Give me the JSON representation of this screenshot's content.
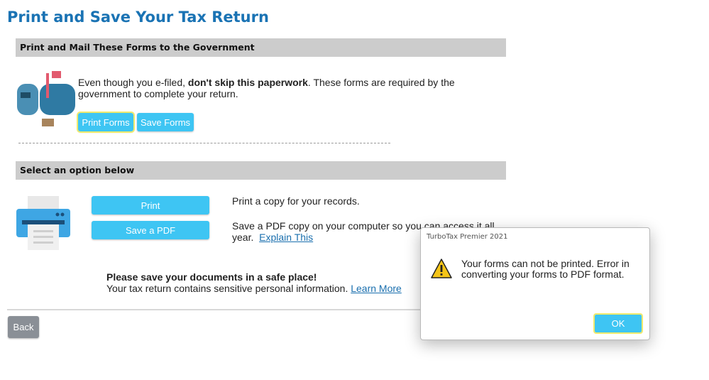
{
  "page_title": "Print and Save Your Tax Return",
  "section1": {
    "heading": "Print and Mail These Forms to the Government",
    "text_before": "Even though you e-filed, ",
    "text_bold": "don't skip this paperwork",
    "text_after": ". These forms are required by the government to complete your return.",
    "print_forms_label": "Print Forms",
    "save_forms_label": "Save Forms",
    "divider": "----------------------------------------------------------------------------------------------------------------------------------------"
  },
  "section2": {
    "heading": "Select an option below",
    "print_label": "Print",
    "save_pdf_label": "Save a PDF",
    "print_desc": "Print a copy for your records.",
    "save_desc": "Save a PDF copy on your computer so you can access it all year.",
    "explain_link": "Explain This"
  },
  "safe_notice": {
    "title": "Please save your documents in a safe place!",
    "body": "Your tax return contains sensitive personal information.",
    "link": "Learn More"
  },
  "back_label": "Back",
  "dialog": {
    "title": "TurboTax Premier 2021",
    "message": "Your forms can not be printed. Error in converting your forms to PDF format.",
    "ok_label": "OK"
  },
  "colors": {
    "accent": "#3ec5f3",
    "title_blue": "#1a73b4",
    "section_bar": "#cccccc",
    "focus_outline": "#f2ea6c"
  }
}
